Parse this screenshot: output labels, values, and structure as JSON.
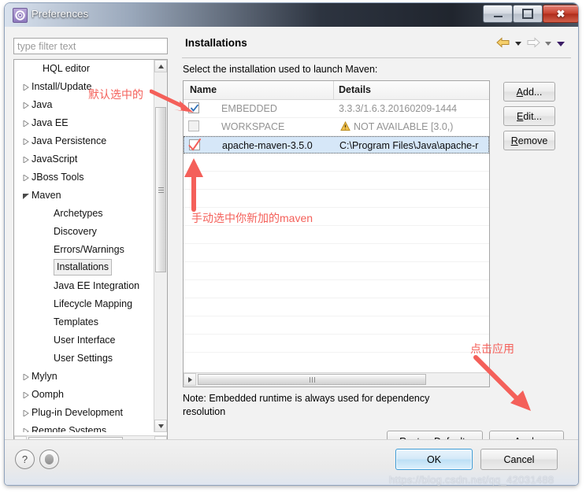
{
  "window": {
    "title": "Preferences",
    "icon": "preferences-gear-icon",
    "controls": {
      "minimize": "minimize-icon",
      "maximize": "maximize-icon",
      "close": "✖"
    }
  },
  "sidebar": {
    "filter": {
      "placeholder": "type filter text",
      "value": ""
    },
    "items": [
      {
        "label": "HQL editor",
        "indent": 1,
        "arrow": "none",
        "selected": false
      },
      {
        "label": "Install/Update",
        "indent": 0,
        "arrow": "collapsed",
        "selected": false
      },
      {
        "label": "Java",
        "indent": 0,
        "arrow": "collapsed",
        "selected": false
      },
      {
        "label": "Java EE",
        "indent": 0,
        "arrow": "collapsed",
        "selected": false
      },
      {
        "label": "Java Persistence",
        "indent": 0,
        "arrow": "collapsed",
        "selected": false
      },
      {
        "label": "JavaScript",
        "indent": 0,
        "arrow": "collapsed",
        "selected": false
      },
      {
        "label": "JBoss Tools",
        "indent": 0,
        "arrow": "collapsed",
        "selected": false
      },
      {
        "label": "Maven",
        "indent": 0,
        "arrow": "expanded",
        "selected": false
      },
      {
        "label": "Archetypes",
        "indent": 2,
        "arrow": "none",
        "selected": false
      },
      {
        "label": "Discovery",
        "indent": 2,
        "arrow": "none",
        "selected": false
      },
      {
        "label": "Errors/Warnings",
        "indent": 2,
        "arrow": "none",
        "selected": false
      },
      {
        "label": "Installations",
        "indent": 2,
        "arrow": "none",
        "selected": true
      },
      {
        "label": "Java EE Integration",
        "indent": 2,
        "arrow": "none",
        "selected": false
      },
      {
        "label": "Lifecycle Mapping",
        "indent": 2,
        "arrow": "none",
        "selected": false
      },
      {
        "label": "Templates",
        "indent": 2,
        "arrow": "none",
        "selected": false
      },
      {
        "label": "User Interface",
        "indent": 2,
        "arrow": "none",
        "selected": false
      },
      {
        "label": "User Settings",
        "indent": 2,
        "arrow": "none",
        "selected": false
      },
      {
        "label": "Mylyn",
        "indent": 0,
        "arrow": "collapsed",
        "selected": false
      },
      {
        "label": "Oomph",
        "indent": 0,
        "arrow": "collapsed",
        "selected": false
      },
      {
        "label": "Plug-in Development",
        "indent": 0,
        "arrow": "collapsed",
        "selected": false
      },
      {
        "label": "Remote Systems",
        "indent": 0,
        "arrow": "collapsed",
        "selected": false
      }
    ]
  },
  "page": {
    "title": "Installations",
    "description": "Select the installation used to launch Maven:",
    "nav": {
      "back_icon": "back-arrow-icon",
      "back_menu_icon": "chevron-down-icon",
      "forward_icon": "forward-arrow-icon",
      "forward_menu_icon": "chevron-down-icon",
      "view_menu_icon": "chevron-down-icon"
    },
    "table": {
      "columns": [
        "Name",
        "Details"
      ],
      "rows": [
        {
          "checked": true,
          "name": "EMBEDDED",
          "details": "3.3.3/1.6.3.20160209-1444",
          "greyed": true,
          "selected": false,
          "warning": false
        },
        {
          "checked": false,
          "name": "WORKSPACE",
          "details": "NOT AVAILABLE [3.0,)",
          "greyed": true,
          "selected": false,
          "warning": true
        },
        {
          "checked": false,
          "name": "apache-maven-3.5.0",
          "details": "C:\\Program Files\\Java\\apache-r",
          "greyed": false,
          "selected": true,
          "warning": false
        }
      ],
      "empty_row_count": 11
    },
    "side_buttons": [
      {
        "name": "add-button",
        "prefix": "",
        "mnemonic": "A",
        "suffix": "dd..."
      },
      {
        "name": "edit-button",
        "prefix": "",
        "mnemonic": "E",
        "suffix": "dit..."
      },
      {
        "name": "remove-button",
        "prefix": "",
        "mnemonic": "R",
        "suffix": "emove"
      }
    ],
    "note_line1": "Note: Embedded runtime is always used for dependency",
    "note_line2": "resolution",
    "restore_defaults": {
      "prefix": "Restore ",
      "mnemonic": "D",
      "suffix": "efaults"
    },
    "apply": {
      "prefix": "",
      "mnemonic": "A",
      "suffix": "pply"
    }
  },
  "footer": {
    "help_icon": "?",
    "tray_icon": "tray-icon",
    "ok_label": "OK",
    "cancel_label": "Cancel"
  },
  "watermark": "https://blog.csdn.net/qq_42031488",
  "annotations": [
    {
      "text": "默认选中的"
    },
    {
      "text": "手动选中你新加的maven"
    },
    {
      "text": "点击应用"
    }
  ],
  "colors": {
    "annotation_red": "#f4605a",
    "selection_blue": "#d6e7f8",
    "ok_accent": "#3c9bd6"
  }
}
